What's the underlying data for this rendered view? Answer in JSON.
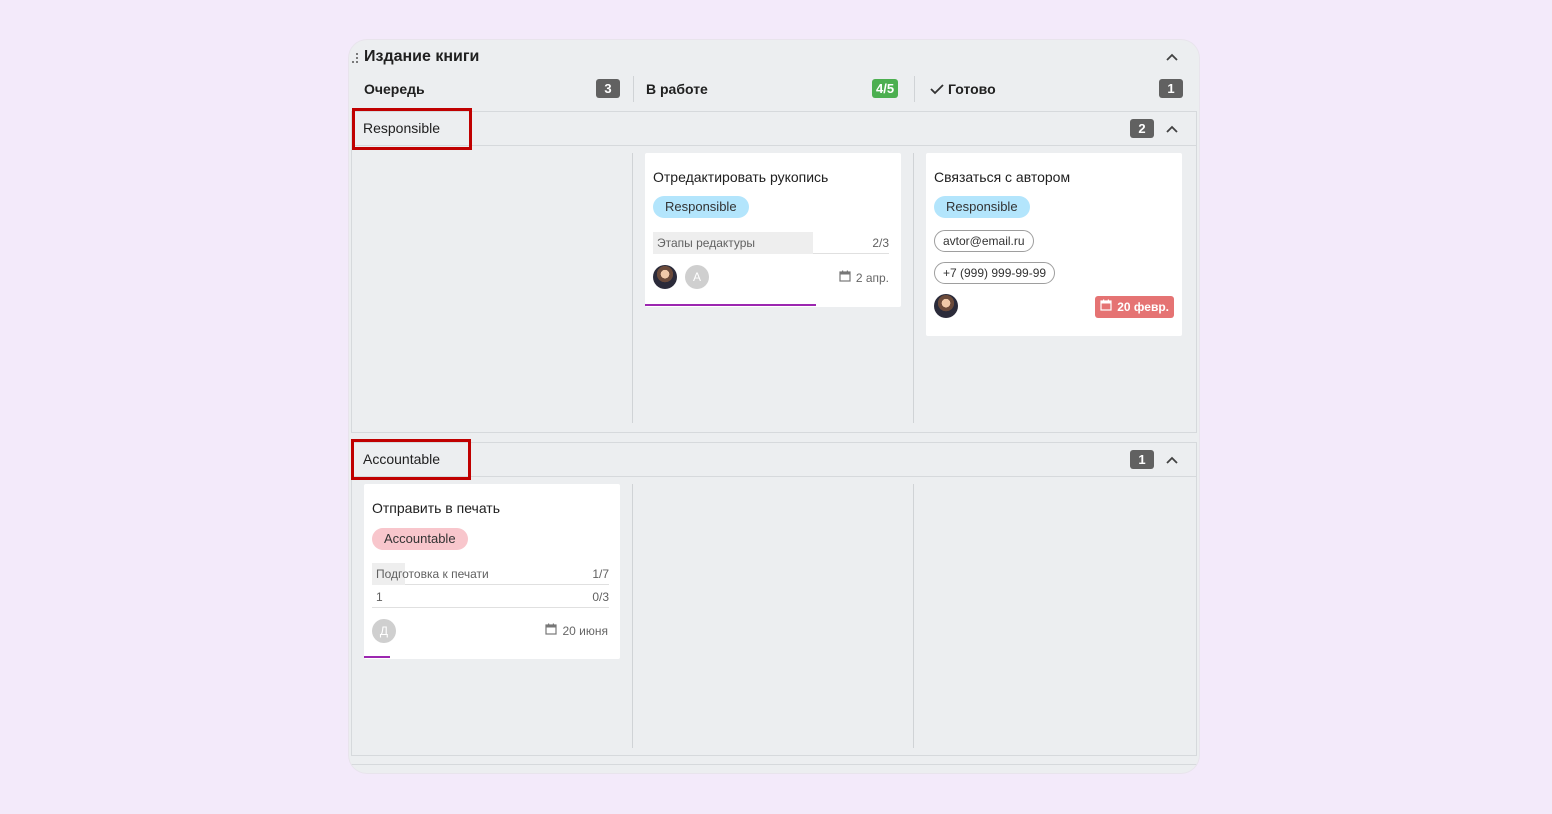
{
  "board": {
    "title": "Издание книги",
    "columns": [
      {
        "title": "Очередь",
        "count": "3",
        "count_color": "#616161"
      },
      {
        "title": "В работе",
        "count": "4/5",
        "count_color": "#4caf50"
      },
      {
        "title": "Готово",
        "count": "1",
        "count_color": "#616161",
        "icon": "check-icon"
      }
    ]
  },
  "swimlanes": [
    {
      "title": "Responsible",
      "count": "2",
      "cards": [
        {
          "title": "Отредактировать рукопись",
          "tag": "Responsible",
          "checklist": {
            "name": "Этапы редактуры",
            "count": "2/3",
            "progress": 0.67
          },
          "avatars": [
            "photo-avatar",
            "А"
          ],
          "due": "2 апр.",
          "progress": 0.67
        },
        {
          "title": "Связаться с автором",
          "tag": "Responsible",
          "email": "avtor@email.ru",
          "phone": "+7 (999) 999-99-99",
          "avatars": [
            "photo-avatar"
          ],
          "due": "20 февр.",
          "due_overdue": true
        }
      ]
    },
    {
      "title": "Accountable",
      "count": "1",
      "cards": [
        {
          "title": "Отправить в печать",
          "tag": "Accountable",
          "checklists": [
            {
              "name": "Подготовка к печати",
              "count": "1/7",
              "progress": 0.14
            },
            {
              "name": "1",
              "count": "0/3",
              "progress": 0
            }
          ],
          "avatars": [
            "Д"
          ],
          "due": "20 июня",
          "progress": 0.1
        }
      ]
    }
  ],
  "colors": {
    "background": "#f3eafa",
    "board": "#eceef0",
    "tag_responsible": "#b3e5fc",
    "tag_accountable": "#f8c6cc",
    "overdue": "#e57373",
    "progress": "#9c27b0",
    "highlight": "#c00000"
  }
}
